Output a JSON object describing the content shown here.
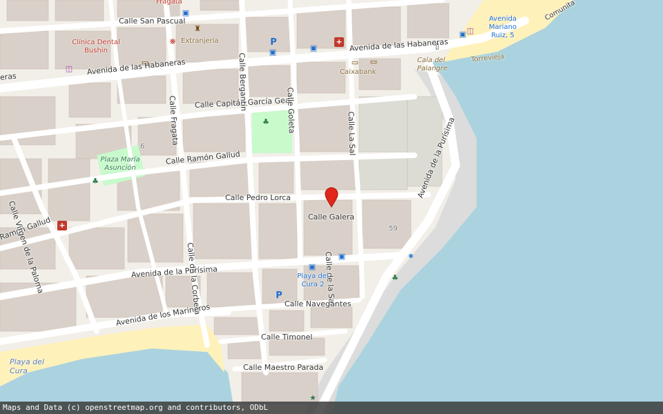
{
  "streets": {
    "san_pascual": "Calle San Pascual",
    "habaneras_left": "Avenida de las Habaneras",
    "habaneras_right": "Avenida de las Habaneras",
    "capitan": "Calle Capitán García Gea",
    "bergantin": "Calle Bergantín",
    "goleta": "Calle Goleta",
    "la_sal": "Calle La Sal",
    "fragata": "Calle Fragata",
    "ramon_gallud": "Calle Ramón Gallud",
    "ramon_gallud_left": "Ramón Gallud",
    "virgen": "Calle Virgen de la Paloma",
    "pedro_lorca": "Calle Pedro Lorca",
    "galera": "Calle Galera",
    "corbeta": "Calle de la Corbeta",
    "de_la_sal": "Calle de la Sal",
    "purisima": "Avenida de la Purísima",
    "purisima_diag": "Avenida de la Purísima",
    "navegantes": "Calle Navegantes",
    "timonel": "Calle Timonel",
    "maestro": "Calle Maestro Parada",
    "marineros": "Avenida de los Marineros",
    "habaneras_left_edge": "eras",
    "comunita": "Comunita"
  },
  "pois": {
    "clinica": "Clínica Dental Bushin",
    "extranjeria": "Extranjería",
    "fragata_top": "Fragata",
    "caixabank": "Caixabank",
    "plaza_maria": "Plaza María Asunción",
    "playa_cura_2": "Playa del Cura 2",
    "playa_del_cura": "Playa del Cura",
    "cala_palangre": "Cala del Palangre",
    "avenida_mariano": "Avenida Mariano Ruiz, 5",
    "torrevieja": "Torrevieja",
    "house_59": "59",
    "house_6": "6"
  },
  "marker": {
    "name": "location-marker",
    "color": "#e0271b"
  },
  "icons": {
    "parking": "P",
    "pharmacy": "+",
    "bus": "bus-icon",
    "atm": "atm-icon",
    "playground": "playground-icon",
    "shop": "shop-icon",
    "vet": "vet-icon",
    "toilets": "toilets-icon"
  },
  "colors": {
    "land": "#f2efe9",
    "building": "#d9d0c9",
    "road": "#ffffff",
    "sea": "#aad3df",
    "beach": "#fff1ba",
    "park": "#c8facc",
    "marker": "#e0271b"
  },
  "attribution": "Maps and Data (c) openstreetmap.org and contributors, ODbL"
}
